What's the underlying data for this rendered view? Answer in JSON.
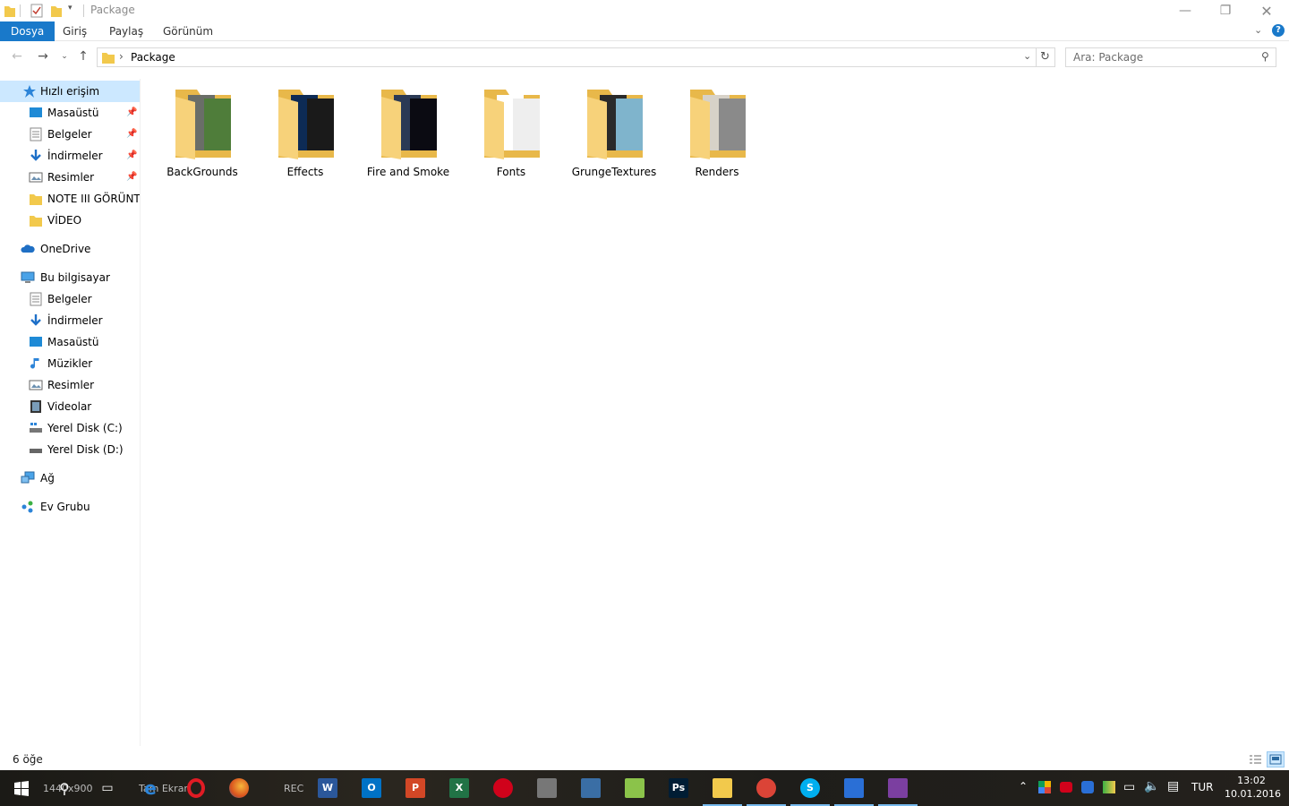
{
  "window": {
    "title": "Package"
  },
  "ribbon": {
    "tabs": [
      {
        "label": "Dosya",
        "active": true
      },
      {
        "label": "Giriş",
        "active": false
      },
      {
        "label": "Paylaş",
        "active": false
      },
      {
        "label": "Görünüm",
        "active": false
      }
    ]
  },
  "address": {
    "path": "Package",
    "separator": "›"
  },
  "search": {
    "placeholder": "Ara: Package"
  },
  "sidebar": {
    "items": [
      {
        "label": "Hızlı erişim",
        "icon": "star-icon",
        "selected": true,
        "pinned": false
      },
      {
        "label": "Masaüstü",
        "icon": "desktop-icon",
        "pinned": true
      },
      {
        "label": "Belgeler",
        "icon": "documents-icon",
        "pinned": true
      },
      {
        "label": "İndirmeler",
        "icon": "downloads-icon",
        "pinned": true
      },
      {
        "label": "Resimler",
        "icon": "pictures-icon",
        "pinned": true
      },
      {
        "label": "NOTE III GÖRÜNTÜLERİ",
        "icon": "folder-icon",
        "pinned": false
      },
      {
        "label": "VİDEO",
        "icon": "folder-icon",
        "pinned": false
      },
      {
        "label": "OneDrive",
        "icon": "onedrive-icon",
        "pinned": false
      },
      {
        "label": "Bu bilgisayar",
        "icon": "computer-icon",
        "pinned": false
      },
      {
        "label": "Belgeler",
        "icon": "documents-icon",
        "pinned": false
      },
      {
        "label": "İndirmeler",
        "icon": "downloads-icon",
        "pinned": false
      },
      {
        "label": "Masaüstü",
        "icon": "desktop-icon",
        "pinned": false
      },
      {
        "label": "Müzikler",
        "icon": "music-icon",
        "pinned": false
      },
      {
        "label": "Resimler",
        "icon": "pictures-icon",
        "pinned": false
      },
      {
        "label": "Videolar",
        "icon": "videos-icon",
        "pinned": false
      },
      {
        "label": "Yerel Disk (C:)",
        "icon": "system-drive-icon",
        "pinned": false
      },
      {
        "label": "Yerel Disk (D:)",
        "icon": "drive-icon",
        "pinned": false
      },
      {
        "label": "Ağ",
        "icon": "network-icon",
        "pinned": false
      },
      {
        "label": "Ev Grubu",
        "icon": "homegroup-icon",
        "pinned": false
      }
    ]
  },
  "folders": [
    {
      "name": "BackGrounds",
      "preview_colors": [
        "#6a6e68",
        "#4f7d3a"
      ]
    },
    {
      "name": "Effects",
      "preview_colors": [
        "#0d2b55",
        "#1a1a1a"
      ]
    },
    {
      "name": "Fire and Smoke",
      "preview_colors": [
        "#2b3a55",
        "#0b0b12"
      ]
    },
    {
      "name": "Fonts",
      "preview_colors": [
        "#ffffff",
        "#eeeeee"
      ]
    },
    {
      "name": "GrungeTextures",
      "preview_colors": [
        "#2a2a2a",
        "#7fb4cc"
      ]
    },
    {
      "name": "Renders",
      "preview_colors": [
        "#d7d2c8",
        "#8a8a8a"
      ]
    }
  ],
  "status": {
    "item_count": "6 öğe"
  },
  "taskbar": {
    "overlay_text_1": "1440x900",
    "overlay_text_2": "Tam Ekran",
    "overlay_text_3": "REC",
    "apps": [
      {
        "name": "word",
        "label": "W",
        "color": "#2b579a"
      },
      {
        "name": "outlook",
        "label": "O",
        "color": "#0072c6"
      },
      {
        "name": "powerpoint",
        "label": "P",
        "color": "#d24726"
      },
      {
        "name": "excel",
        "label": "X",
        "color": "#217346"
      },
      {
        "name": "recorder",
        "label": "",
        "color": "#d0021b"
      },
      {
        "name": "tool",
        "label": "",
        "color": "#777777"
      },
      {
        "name": "network-manager",
        "label": "",
        "color": "#3a6ea5"
      },
      {
        "name": "notepad-plus",
        "label": "",
        "color": "#8bc34a"
      },
      {
        "name": "photoshop",
        "label": "Ps",
        "color": "#001d34"
      },
      {
        "name": "file-explorer",
        "label": "",
        "color": "#f2c94c"
      },
      {
        "name": "chrome",
        "label": "",
        "color": "#db4437"
      },
      {
        "name": "skype",
        "label": "S",
        "color": "#00aff0"
      },
      {
        "name": "app-moon",
        "label": "",
        "color": "#2a6fd6"
      },
      {
        "name": "winrar",
        "label": "",
        "color": "#7b3fa0"
      }
    ],
    "language": "TUR",
    "time": "13:02",
    "date": "10.01.2016"
  }
}
